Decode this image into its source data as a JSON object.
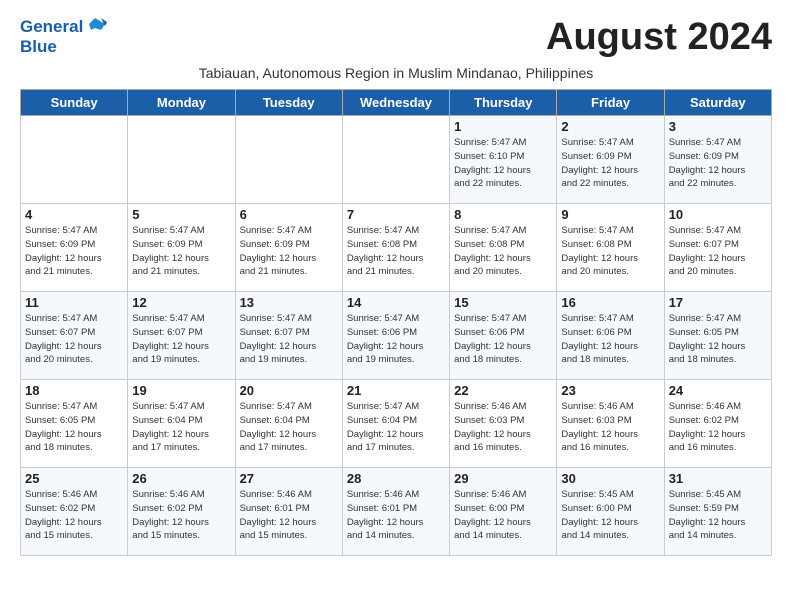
{
  "logo": {
    "line1": "General",
    "line2": "Blue"
  },
  "title": "August 2024",
  "subtitle": "Tabiauan, Autonomous Region in Muslim Mindanao, Philippines",
  "days_of_week": [
    "Sunday",
    "Monday",
    "Tuesday",
    "Wednesday",
    "Thursday",
    "Friday",
    "Saturday"
  ],
  "weeks": [
    [
      {
        "day": "",
        "info": ""
      },
      {
        "day": "",
        "info": ""
      },
      {
        "day": "",
        "info": ""
      },
      {
        "day": "",
        "info": ""
      },
      {
        "day": "1",
        "info": "Sunrise: 5:47 AM\nSunset: 6:10 PM\nDaylight: 12 hours\nand 22 minutes."
      },
      {
        "day": "2",
        "info": "Sunrise: 5:47 AM\nSunset: 6:09 PM\nDaylight: 12 hours\nand 22 minutes."
      },
      {
        "day": "3",
        "info": "Sunrise: 5:47 AM\nSunset: 6:09 PM\nDaylight: 12 hours\nand 22 minutes."
      }
    ],
    [
      {
        "day": "4",
        "info": "Sunrise: 5:47 AM\nSunset: 6:09 PM\nDaylight: 12 hours\nand 21 minutes."
      },
      {
        "day": "5",
        "info": "Sunrise: 5:47 AM\nSunset: 6:09 PM\nDaylight: 12 hours\nand 21 minutes."
      },
      {
        "day": "6",
        "info": "Sunrise: 5:47 AM\nSunset: 6:09 PM\nDaylight: 12 hours\nand 21 minutes."
      },
      {
        "day": "7",
        "info": "Sunrise: 5:47 AM\nSunset: 6:08 PM\nDaylight: 12 hours\nand 21 minutes."
      },
      {
        "day": "8",
        "info": "Sunrise: 5:47 AM\nSunset: 6:08 PM\nDaylight: 12 hours\nand 20 minutes."
      },
      {
        "day": "9",
        "info": "Sunrise: 5:47 AM\nSunset: 6:08 PM\nDaylight: 12 hours\nand 20 minutes."
      },
      {
        "day": "10",
        "info": "Sunrise: 5:47 AM\nSunset: 6:07 PM\nDaylight: 12 hours\nand 20 minutes."
      }
    ],
    [
      {
        "day": "11",
        "info": "Sunrise: 5:47 AM\nSunset: 6:07 PM\nDaylight: 12 hours\nand 20 minutes."
      },
      {
        "day": "12",
        "info": "Sunrise: 5:47 AM\nSunset: 6:07 PM\nDaylight: 12 hours\nand 19 minutes."
      },
      {
        "day": "13",
        "info": "Sunrise: 5:47 AM\nSunset: 6:07 PM\nDaylight: 12 hours\nand 19 minutes."
      },
      {
        "day": "14",
        "info": "Sunrise: 5:47 AM\nSunset: 6:06 PM\nDaylight: 12 hours\nand 19 minutes."
      },
      {
        "day": "15",
        "info": "Sunrise: 5:47 AM\nSunset: 6:06 PM\nDaylight: 12 hours\nand 18 minutes."
      },
      {
        "day": "16",
        "info": "Sunrise: 5:47 AM\nSunset: 6:06 PM\nDaylight: 12 hours\nand 18 minutes."
      },
      {
        "day": "17",
        "info": "Sunrise: 5:47 AM\nSunset: 6:05 PM\nDaylight: 12 hours\nand 18 minutes."
      }
    ],
    [
      {
        "day": "18",
        "info": "Sunrise: 5:47 AM\nSunset: 6:05 PM\nDaylight: 12 hours\nand 18 minutes."
      },
      {
        "day": "19",
        "info": "Sunrise: 5:47 AM\nSunset: 6:04 PM\nDaylight: 12 hours\nand 17 minutes."
      },
      {
        "day": "20",
        "info": "Sunrise: 5:47 AM\nSunset: 6:04 PM\nDaylight: 12 hours\nand 17 minutes."
      },
      {
        "day": "21",
        "info": "Sunrise: 5:47 AM\nSunset: 6:04 PM\nDaylight: 12 hours\nand 17 minutes."
      },
      {
        "day": "22",
        "info": "Sunrise: 5:46 AM\nSunset: 6:03 PM\nDaylight: 12 hours\nand 16 minutes."
      },
      {
        "day": "23",
        "info": "Sunrise: 5:46 AM\nSunset: 6:03 PM\nDaylight: 12 hours\nand 16 minutes."
      },
      {
        "day": "24",
        "info": "Sunrise: 5:46 AM\nSunset: 6:02 PM\nDaylight: 12 hours\nand 16 minutes."
      }
    ],
    [
      {
        "day": "25",
        "info": "Sunrise: 5:46 AM\nSunset: 6:02 PM\nDaylight: 12 hours\nand 15 minutes."
      },
      {
        "day": "26",
        "info": "Sunrise: 5:46 AM\nSunset: 6:02 PM\nDaylight: 12 hours\nand 15 minutes."
      },
      {
        "day": "27",
        "info": "Sunrise: 5:46 AM\nSunset: 6:01 PM\nDaylight: 12 hours\nand 15 minutes."
      },
      {
        "day": "28",
        "info": "Sunrise: 5:46 AM\nSunset: 6:01 PM\nDaylight: 12 hours\nand 14 minutes."
      },
      {
        "day": "29",
        "info": "Sunrise: 5:46 AM\nSunset: 6:00 PM\nDaylight: 12 hours\nand 14 minutes."
      },
      {
        "day": "30",
        "info": "Sunrise: 5:45 AM\nSunset: 6:00 PM\nDaylight: 12 hours\nand 14 minutes."
      },
      {
        "day": "31",
        "info": "Sunrise: 5:45 AM\nSunset: 5:59 PM\nDaylight: 12 hours\nand 14 minutes."
      }
    ]
  ]
}
